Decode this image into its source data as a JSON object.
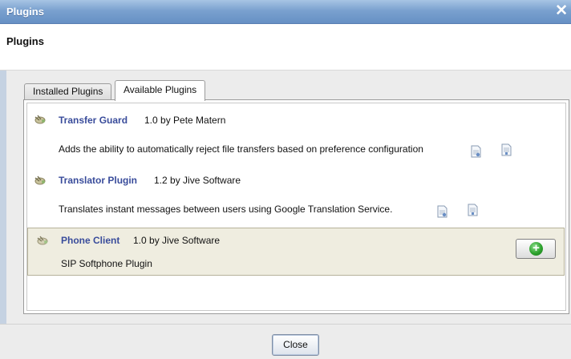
{
  "window": {
    "title": "Plugins",
    "close_glyph": "✕"
  },
  "header": {
    "heading": "Plugins"
  },
  "tabs": [
    {
      "label": "Installed Plugins",
      "active": false
    },
    {
      "label": "Available Plugins",
      "active": true
    }
  ],
  "plugins": [
    {
      "name": "Transfer Guard",
      "version": "1.0 by Pete Matern",
      "description": "Adds the ability to automatically reject file transfers based on preference configuration",
      "icon": "plug-icon"
    },
    {
      "name": "Translator Plugin",
      "version": "1.2 by Jive Software",
      "description": "Translates instant messages between users using Google Translation Service.",
      "icon": "plug-icon"
    },
    {
      "name": "Phone Client",
      "version": "1.0 by Jive Software",
      "description": "SIP Softphone Plugin",
      "icon": "plug-icon",
      "selected": true
    }
  ],
  "install_button": {
    "icon": "add-icon",
    "glyph": "+"
  },
  "footer": {
    "close_label": "Close"
  },
  "colors": {
    "title_bar": "#7aa1cf",
    "plugin_name": "#394c9b",
    "selected_row": "#efede0",
    "install_green": "#2da12d"
  }
}
